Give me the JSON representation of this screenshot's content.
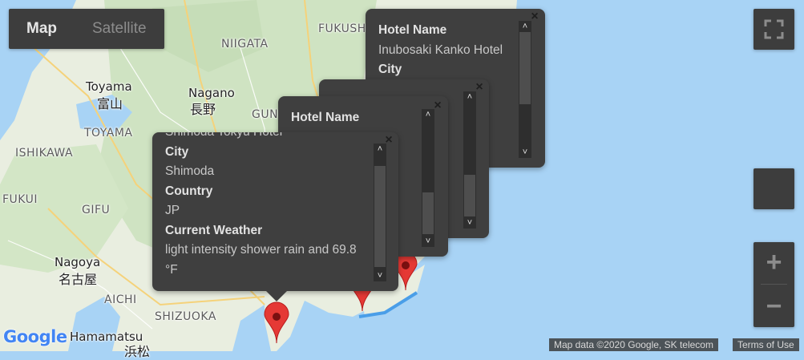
{
  "map_type_control": {
    "map_label": "Map",
    "satellite_label": "Satellite"
  },
  "map_labels": {
    "fukushima": "FUKUSH",
    "niigata": "NIIGATA",
    "toyama": "Toyama",
    "toyama_jp": "富山",
    "toyama_pref": "TOYAMA",
    "nagano": "Nagano",
    "nagano_jp": "長野",
    "gunma": "GUN",
    "ishikawa": "ISHIKAWA",
    "fukui": "FUKUI",
    "gifu": "GIFU",
    "nagoya": "Nagoya",
    "nagoya_jp": "名古屋",
    "aichi": "AICHI",
    "shizuoka": "SHIZUOKA",
    "hamamatsu": "Hamamatsu",
    "hamamatsu_jp": "浜松"
  },
  "info_windows": {
    "back": {
      "label1": "Hotel Name",
      "value1": "Inubosaki Kanko Hotel",
      "label2": "City"
    },
    "mid": {
      "label1": "Hotel Name"
    },
    "front": {
      "partial_line": "Shimoda Tokyu Hotel",
      "city_label": "City",
      "city_value": "Shimoda",
      "country_label": "Country",
      "country_value": "JP",
      "weather_label": "Current Weather",
      "weather_value": "light intensity shower rain and 69.8",
      "weather_unit": "°F"
    }
  },
  "icons": {
    "close": "×",
    "scroll_up": "˄",
    "scroll_down": "˅",
    "zoom_in": "+",
    "zoom_out": "−"
  },
  "google_logo": "Google",
  "attribution": {
    "map_data": "Map data ©2020 Google, SK telecom",
    "terms": "Terms of Use"
  },
  "colors": {
    "marker": "#e53935",
    "panel": "#3d3d3d",
    "water": "#a8d3f5",
    "land": "#e9eee0"
  }
}
